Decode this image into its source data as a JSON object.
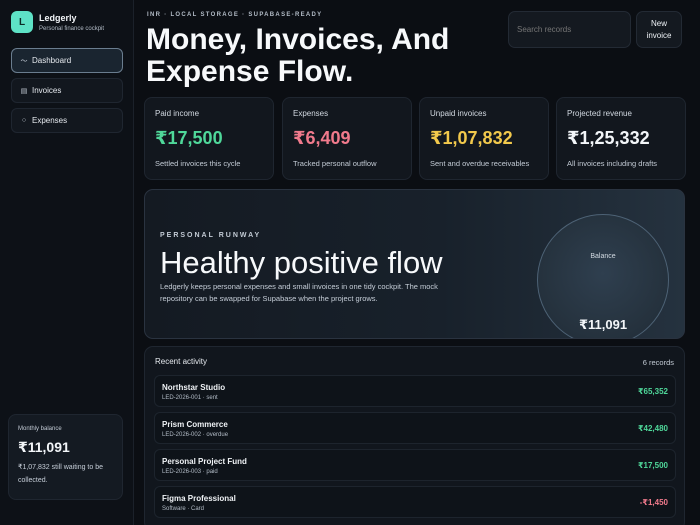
{
  "colors": {
    "accent": "#5ee2c6",
    "positive": "#4fd89a",
    "negative": "#f07a8c",
    "warning": "#f2c94c",
    "neutral": "#f3f6f9"
  },
  "sidebar": {
    "brand": {
      "logo_letter": "L",
      "name": "Ledgerly",
      "subtitle": "Personal finance cockpit"
    },
    "nav": [
      {
        "label": "Dashboard",
        "icon": "trend-icon",
        "glyph": "〜",
        "active": true
      },
      {
        "label": "Invoices",
        "icon": "list-icon",
        "glyph": "▤",
        "active": false
      },
      {
        "label": "Expenses",
        "icon": "circle-icon",
        "glyph": "○",
        "active": false
      }
    ],
    "monthly_balance": {
      "label": "Monthly balance",
      "value": "₹11,091",
      "note": "₹1,07,832 still waiting to be collected."
    }
  },
  "header": {
    "eyebrow": "INR · LOCAL STORAGE · SUPABASE-READY",
    "title": "Money, Invoices, And Expense Flow.",
    "search_placeholder": "Search records",
    "new_button": "New invoice"
  },
  "stats": [
    {
      "label": "Paid income",
      "value": "₹17,500",
      "description": "Settled invoices this cycle",
      "tone": "positive"
    },
    {
      "label": "Expenses",
      "value": "₹6,409",
      "description": "Tracked personal outflow",
      "tone": "negative"
    },
    {
      "label": "Unpaid invoices",
      "value": "₹1,07,832",
      "description": "Sent and overdue receivables",
      "tone": "warning"
    },
    {
      "label": "Projected revenue",
      "value": "₹1,25,332",
      "description": "All invoices including drafts",
      "tone": "neutral"
    }
  ],
  "runway": {
    "eyebrow": "PERSONAL RUNWAY",
    "title": "Healthy positive flow",
    "text": "Ledgerly keeps personal expenses and small invoices in one tidy cockpit. The mock repository can be swapped for Supabase when the project grows.",
    "balance_label": "Balance",
    "balance_value": "₹11,091"
  },
  "activity": {
    "title": "Recent activity",
    "count": "6 records",
    "rows": [
      {
        "name": "Northstar Studio",
        "meta": "LED-2026-001 · sent",
        "amount": "₹65,352",
        "tone": "positive"
      },
      {
        "name": "Prism Commerce",
        "meta": "LED-2026-002 · overdue",
        "amount": "₹42,480",
        "tone": "positive"
      },
      {
        "name": "Personal Project Fund",
        "meta": "LED-2026-003 · paid",
        "amount": "₹17,500",
        "tone": "positive"
      },
      {
        "name": "Figma Professional",
        "meta": "Software · Card",
        "amount": "-₹1,450",
        "tone": "negative"
      }
    ]
  }
}
